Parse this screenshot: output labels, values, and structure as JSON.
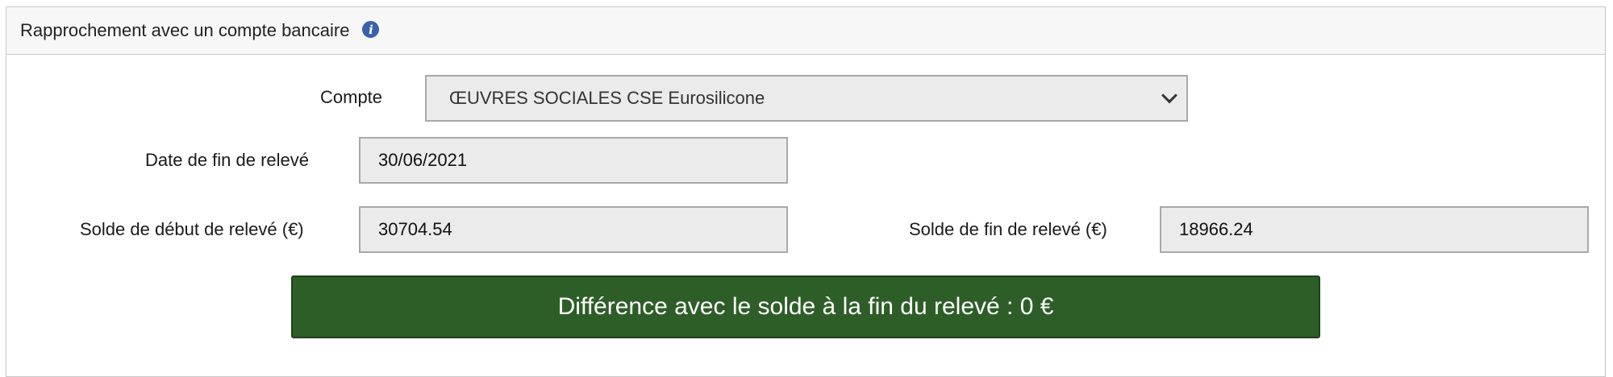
{
  "panel": {
    "title": "Rapprochement avec un compte bancaire",
    "info_icon": "info-icon"
  },
  "form": {
    "account_label": "Compte",
    "account_value": "ŒUVRES SOCIALES CSE Eurosilicone",
    "end_date_label": "Date de fin de relevé",
    "end_date_value": "30/06/2021",
    "start_balance_label": "Solde de début de relevé (€)",
    "start_balance_value": "30704.54",
    "end_balance_label": "Solde de fin de relevé (€)",
    "end_balance_value": "18966.24"
  },
  "result": {
    "difference_label": "Différence avec le solde à la fin du relevé : 0 €"
  },
  "colors": {
    "accent_green": "#2e5e28",
    "info_blue": "#3a62a8"
  }
}
